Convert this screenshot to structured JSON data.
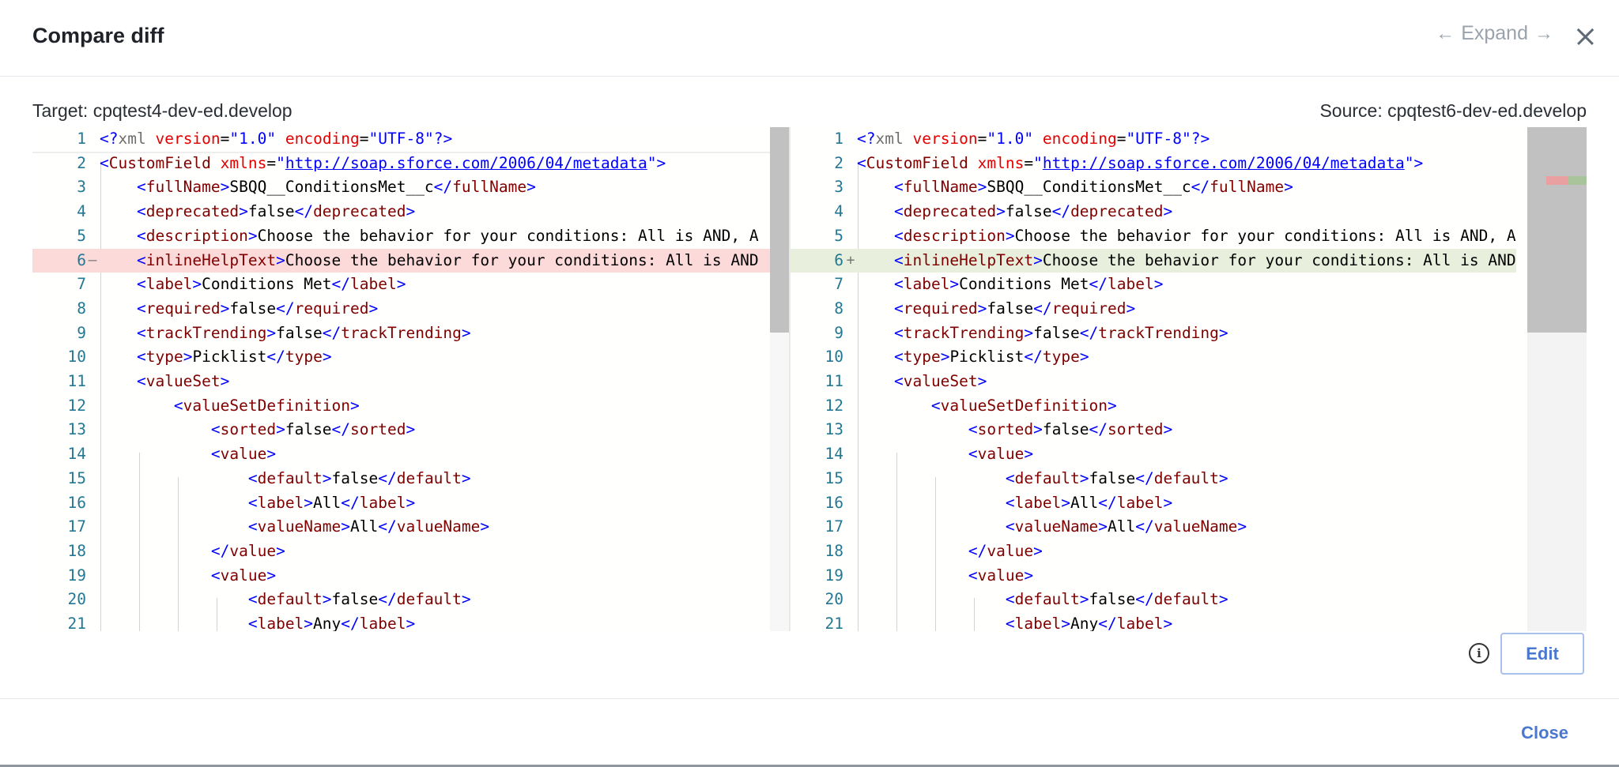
{
  "dialog": {
    "title": "Compare diff",
    "expand_label": "Expand",
    "expand_left_arrow": "←",
    "expand_right_arrow": "→",
    "target_label": "Target: cpqtest4-dev-ed.develop",
    "source_label": "Source: cpqtest6-dev-ed.develop",
    "edit_label": "Edit",
    "close_label": "Close",
    "info_glyph": "i"
  },
  "diff": {
    "removed_marker": "—",
    "added_marker": "+",
    "left_line6_text": "Choose the behavior for your conditions: All is AND",
    "right_line6_text": "Choose the behavior for your conditions: All is AND",
    "line5_text": "Choose the behavior for your conditions: All is AND, A",
    "colors": {
      "removed": "#fddada",
      "added": "#e8efdc",
      "accent": "#4a78d0"
    }
  }
}
